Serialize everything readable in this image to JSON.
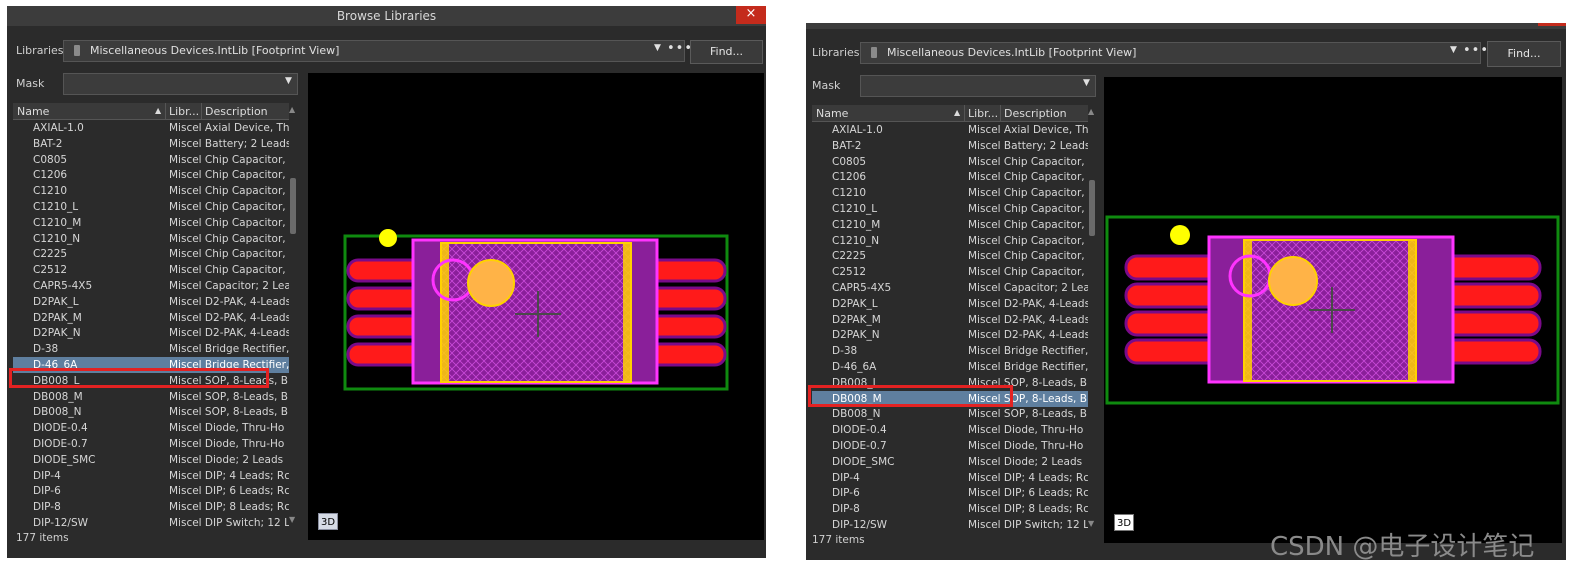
{
  "left": {
    "window_title": "Browse Libraries",
    "close_glyph": "×",
    "libraries_label": "Libraries",
    "library_value": "Miscellaneous Devices.IntLib [Footprint View]",
    "find_label": "Find...",
    "mask_label": "Mask",
    "mask_value": "",
    "columns": {
      "name": "Name",
      "library": "Libr...",
      "description": "Description"
    },
    "selected_index": 15,
    "items": [
      {
        "name": "AXIAL-1.0",
        "desc": "Miscel Axial Device, Th"
      },
      {
        "name": "BAT-2",
        "desc": "Miscel Battery; 2 Leads"
      },
      {
        "name": "C0805",
        "desc": "Miscel Chip Capacitor,"
      },
      {
        "name": "C1206",
        "desc": "Miscel Chip Capacitor,"
      },
      {
        "name": "C1210",
        "desc": "Miscel Chip Capacitor,"
      },
      {
        "name": "C1210_L",
        "desc": "Miscel Chip Capacitor,"
      },
      {
        "name": "C1210_M",
        "desc": "Miscel Chip Capacitor,"
      },
      {
        "name": "C1210_N",
        "desc": "Miscel Chip Capacitor,"
      },
      {
        "name": "C2225",
        "desc": "Miscel Chip Capacitor,"
      },
      {
        "name": "C2512",
        "desc": "Miscel Chip Capacitor,"
      },
      {
        "name": "CAPR5-4X5",
        "desc": "Miscel Capacitor; 2 Lea"
      },
      {
        "name": "D2PAK_L",
        "desc": "Miscel D2-PAK, 4-Leads"
      },
      {
        "name": "D2PAK_M",
        "desc": "Miscel D2-PAK, 4-Leads"
      },
      {
        "name": "D2PAK_N",
        "desc": "Miscel D2-PAK, 4-Leads"
      },
      {
        "name": "D-38",
        "desc": "Miscel Bridge Rectifier,"
      },
      {
        "name": "D-46_6A",
        "desc": "Miscel Bridge Rectifier,"
      },
      {
        "name": "DB008_L",
        "desc": "Miscel SOP, 8-Leads, B"
      },
      {
        "name": "DB008_M",
        "desc": "Miscel SOP, 8-Leads, B"
      },
      {
        "name": "DB008_N",
        "desc": "Miscel SOP, 8-Leads, B"
      },
      {
        "name": "DIODE-0.4",
        "desc": "Miscel Diode, Thru-Ho"
      },
      {
        "name": "DIODE-0.7",
        "desc": "Miscel Diode, Thru-Ho"
      },
      {
        "name": "DIODE_SMC",
        "desc": "Miscel Diode; 2 Leads"
      },
      {
        "name": "DIP-4",
        "desc": "Miscel DIP; 4 Leads; Rc"
      },
      {
        "name": "DIP-6",
        "desc": "Miscel DIP; 6 Leads; Rc"
      },
      {
        "name": "DIP-8",
        "desc": "Miscel DIP; 8 Leads; Rc"
      },
      {
        "name": "DIP-12/SW",
        "desc": "Miscel DIP Switch; 12 L"
      }
    ],
    "item_count": "177 items",
    "btn_3d": "3D"
  },
  "right": {
    "libraries_label": "Libraries",
    "library_value": "Miscellaneous Devices.IntLib [Footprint View]",
    "find_label": "Find...",
    "mask_label": "Mask",
    "mask_value": "",
    "columns": {
      "name": "Name",
      "library": "Libr...",
      "description": "Description"
    },
    "selected_index": 17,
    "items": [
      {
        "name": "AXIAL-1.0",
        "desc": "Miscel Axial Device, Th"
      },
      {
        "name": "BAT-2",
        "desc": "Miscel Battery; 2 Leads"
      },
      {
        "name": "C0805",
        "desc": "Miscel Chip Capacitor,"
      },
      {
        "name": "C1206",
        "desc": "Miscel Chip Capacitor,"
      },
      {
        "name": "C1210",
        "desc": "Miscel Chip Capacitor,"
      },
      {
        "name": "C1210_L",
        "desc": "Miscel Chip Capacitor,"
      },
      {
        "name": "C1210_M",
        "desc": "Miscel Chip Capacitor,"
      },
      {
        "name": "C1210_N",
        "desc": "Miscel Chip Capacitor,"
      },
      {
        "name": "C2225",
        "desc": "Miscel Chip Capacitor,"
      },
      {
        "name": "C2512",
        "desc": "Miscel Chip Capacitor,"
      },
      {
        "name": "CAPR5-4X5",
        "desc": "Miscel Capacitor; 2 Lea"
      },
      {
        "name": "D2PAK_L",
        "desc": "Miscel D2-PAK, 4-Leads"
      },
      {
        "name": "D2PAK_M",
        "desc": "Miscel D2-PAK, 4-Leads"
      },
      {
        "name": "D2PAK_N",
        "desc": "Miscel D2-PAK, 4-Leads"
      },
      {
        "name": "D-38",
        "desc": "Miscel Bridge Rectifier,"
      },
      {
        "name": "D-46_6A",
        "desc": "Miscel Bridge Rectifier,"
      },
      {
        "name": "DB008_L",
        "desc": "Miscel SOP, 8-Leads, B"
      },
      {
        "name": "DB008_M",
        "desc": "Miscel SOP, 8-Leads, B"
      },
      {
        "name": "DB008_N",
        "desc": "Miscel SOP, 8-Leads, B"
      },
      {
        "name": "DIODE-0.4",
        "desc": "Miscel Diode, Thru-Ho"
      },
      {
        "name": "DIODE-0.7",
        "desc": "Miscel Diode, Thru-Ho"
      },
      {
        "name": "DIODE_SMC",
        "desc": "Miscel Diode; 2 Leads"
      },
      {
        "name": "DIP-4",
        "desc": "Miscel DIP; 4 Leads; Rc"
      },
      {
        "name": "DIP-6",
        "desc": "Miscel DIP; 6 Leads; Rc"
      },
      {
        "name": "DIP-8",
        "desc": "Miscel DIP; 8 Leads; Rc"
      },
      {
        "name": "DIP-12/SW",
        "desc": "Miscel DIP Switch; 12 L"
      }
    ],
    "item_count": "177 items",
    "btn_3d": "3D"
  },
  "watermark": "CSDN @电子设计笔记",
  "colors": {
    "panel_bg": "#2b2b2b",
    "selection": "#5f7f9f",
    "highlight_box": "#e32222",
    "pad": "#ff1a1a",
    "pad_outline": "#7a0a8a",
    "component_outline": "#ff33ff",
    "courtyard": "#0f8a0f",
    "body_fill": "#8a1f9a",
    "pin1_marker": "#ffd200"
  }
}
